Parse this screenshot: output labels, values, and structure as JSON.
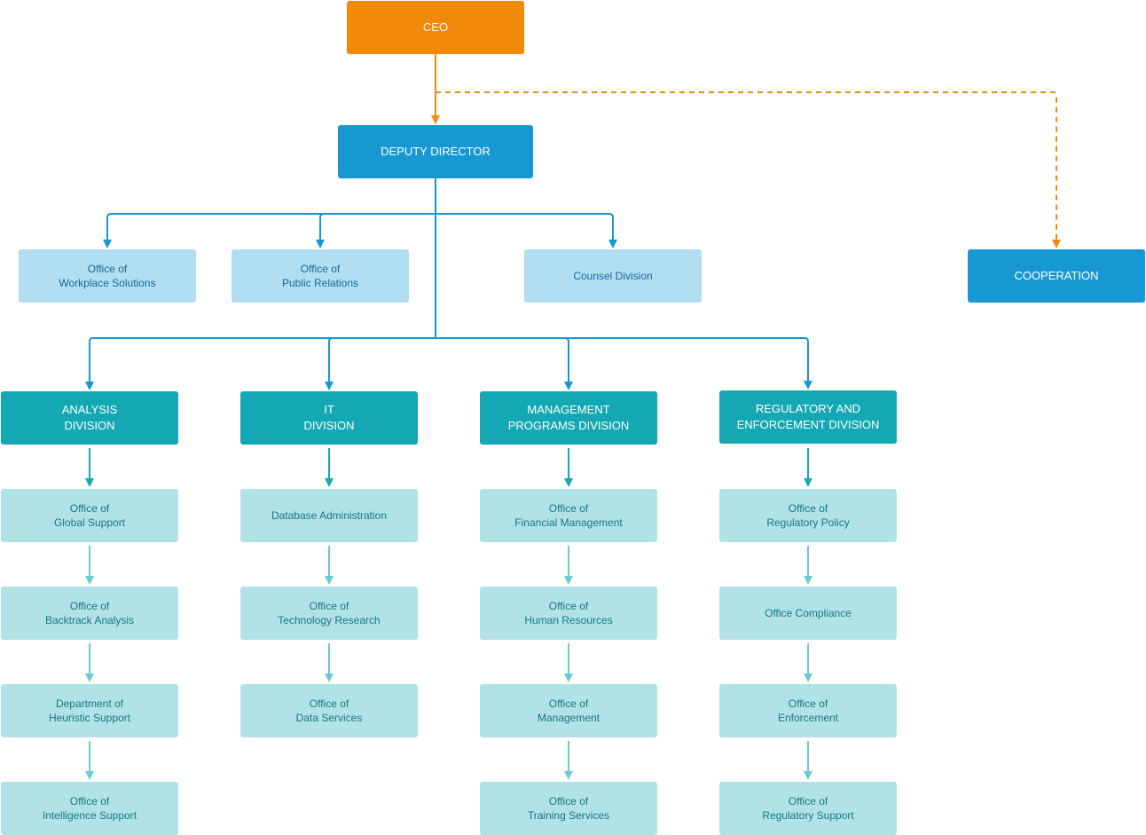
{
  "chart": {
    "type": "org-chart",
    "colors": {
      "ceo": "#f08a08",
      "executive": "#1898d2",
      "staff_office": "#b1def0",
      "division": "#14a8b4",
      "division_office": "#b1e3e6",
      "connector_blue": "#1898d2",
      "connector_teal": "#1aa9b3",
      "connector_light_teal": "#6ccbd2",
      "connector_orange": "#f08a08"
    },
    "ceo": {
      "label": "CEO"
    },
    "deputy": {
      "label": "DEPUTY DIRECTOR"
    },
    "cooperation": {
      "label": "COOPERATION",
      "link_style": "dashed"
    },
    "staff_offices": [
      {
        "label": "Office of\nWorkplace Solutions"
      },
      {
        "label": "Office of\nPublic Relations"
      },
      {
        "label": "Counsel Division"
      }
    ],
    "divisions": [
      {
        "label": "ANALYSIS\nDIVISION",
        "offices": [
          {
            "label": "Office of\nGlobal Support"
          },
          {
            "label": "Office of\nBacktrack Analysis"
          },
          {
            "label": "Department of\nHeuristic Support"
          },
          {
            "label": "Office of\nIntelligence Support"
          }
        ]
      },
      {
        "label": "IT\nDIVISION",
        "offices": [
          {
            "label": "Database Administration"
          },
          {
            "label": "Office of\nTechnology Research"
          },
          {
            "label": "Office of\nData Services"
          }
        ]
      },
      {
        "label": "MANAGEMENT\nPROGRAMS DIVISION",
        "offices": [
          {
            "label": "Office of\nFinancial Management"
          },
          {
            "label": "Office of\nHuman Resources"
          },
          {
            "label": "Office of\nManagement"
          },
          {
            "label": "Office of\nTraining Services"
          }
        ]
      },
      {
        "label": "REGULATORY AND\nENFORCEMENT DIVISION",
        "offices": [
          {
            "label": "Office of\nRegulatory Policy"
          },
          {
            "label": "Office Compliance"
          },
          {
            "label": "Office of\nEnforcement"
          },
          {
            "label": "Office of\nRegulatory Support"
          }
        ]
      }
    ]
  }
}
